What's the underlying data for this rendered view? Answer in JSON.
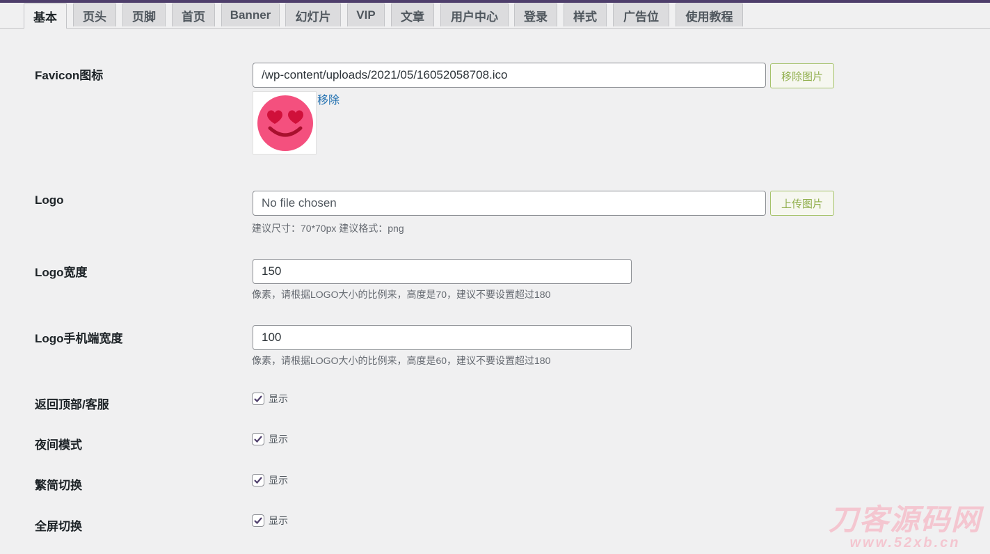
{
  "tabs": [
    "基本",
    "页头",
    "页脚",
    "首页",
    "Banner",
    "幻灯片",
    "VIP",
    "文章",
    "用户中心",
    "登录",
    "样式",
    "广告位",
    "使用教程"
  ],
  "fields": {
    "favicon": {
      "label": "Favicon图标",
      "value": "/wp-content/uploads/2021/05/16052058708.ico",
      "button": "移除图片",
      "remove_link": "移除"
    },
    "logo": {
      "label": "Logo",
      "placeholder": "No file chosen",
      "button": "上传图片",
      "hint": "建议尺寸：70*70px 建议格式：png"
    },
    "logo_width": {
      "label": "Logo宽度",
      "value": "150",
      "hint": "像素，请根据LOGO大小的比例来，高度是70，建议不要设置超过180"
    },
    "logo_mobile_width": {
      "label": "Logo手机端宽度",
      "value": "100",
      "hint": "像素，请根据LOGO大小的比例来，高度是60，建议不要设置超过180"
    }
  },
  "checkboxes": [
    {
      "label": "返回顶部/客服",
      "text": "显示",
      "checked": true
    },
    {
      "label": "夜间模式",
      "text": "显示",
      "checked": true
    },
    {
      "label": "繁简切换",
      "text": "显示",
      "checked": true
    },
    {
      "label": "全屏切换",
      "text": "显示",
      "checked": true
    }
  ],
  "watermark": {
    "main": "刀客源码网",
    "sub": "www.52xb.cn"
  },
  "colors": {
    "accent": "#4e3e6b",
    "button_text": "#8fae4a",
    "link": "#2271b1",
    "emoji": "#f4507e"
  }
}
